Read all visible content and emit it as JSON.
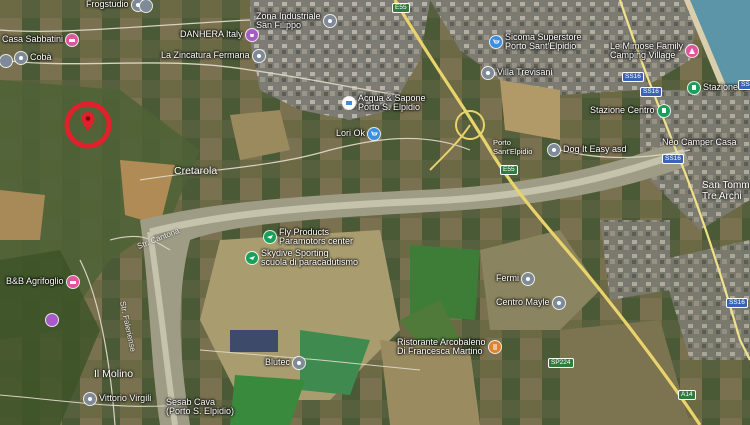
{
  "colors": {
    "field_dark": "#4a5536",
    "field_light": "#9a8c62",
    "river": "#b8b59a",
    "highway": "#e9d36b",
    "road": "#e0e0e0",
    "sea": "#5c95a8",
    "marker_ring": "#e0202a",
    "poi_grey": "#7e8a98",
    "poi_green": "#18a05a",
    "poi_pink": "#e0559d",
    "poi_purple": "#a85ac8",
    "poi_blue": "#3a8fe0",
    "poi_orange": "#e0832a"
  },
  "pois": [
    {
      "label": "Frogstudio",
      "icon": "grey"
    },
    {
      "label": "Casa Sabbatini",
      "icon": "pink"
    },
    {
      "label": "DANHERA Italy",
      "icon": "purple"
    },
    {
      "label": "Zona Industriale\nSan Filippo",
      "icon": "grey"
    },
    {
      "label": "Cobà",
      "icon": "grey"
    },
    {
      "label": "La Zincatura Fermana",
      "icon": "grey"
    },
    {
      "label": "Sicoma Superstore\nPorto Sant'Elpidio",
      "icon": "blue"
    },
    {
      "label": "Le Mimose Family\nCamping Village",
      "icon": "pink"
    },
    {
      "label": "Villa Trevisani",
      "icon": "grey"
    },
    {
      "label": "Acqua & Sapone\nPorto S. Elpidio",
      "icon": "grey"
    },
    {
      "label": "Lori Ok",
      "icon": "grey"
    },
    {
      "label": "Stazione di Porto S. Elpidio",
      "icon": "green"
    },
    {
      "label": "Stazione Centro",
      "icon": "green"
    },
    {
      "label": "Dog It Easy asd",
      "icon": "grey"
    },
    {
      "label": "Neo Camper Casa",
      "icon": "grey"
    },
    {
      "label": "Fly Products\nParamotors center",
      "icon": "green"
    },
    {
      "label": "Skydive Sporting\nscuola di paracadutismo",
      "icon": "green"
    },
    {
      "label": "B&B Agrifoglio",
      "icon": "pink"
    },
    {
      "label": "Fermi",
      "icon": "grey"
    },
    {
      "label": "Centro Mayle",
      "icon": "grey"
    },
    {
      "label": "Ristorante Arcobaleno\nDi Francesca Martino",
      "icon": "orange"
    },
    {
      "label": "Blutec",
      "icon": "grey"
    },
    {
      "label": "Vittorio Virgili",
      "icon": "grey"
    },
    {
      "label": "Sesab Cava\n(Porto S. Elpidio)",
      "icon": "grey"
    }
  ],
  "places": [
    "Cretarola",
    "San Tommaso\nTre Archi",
    "Il Molino",
    "Porto\nSant'Elpidio"
  ],
  "roads": [
    "Str. Cantona",
    "Str. Faleriense"
  ],
  "shields": [
    "E55",
    "SS16",
    "SS16",
    "E55",
    "SS16",
    "SP224",
    "A14",
    "SS16",
    "SS16"
  ]
}
